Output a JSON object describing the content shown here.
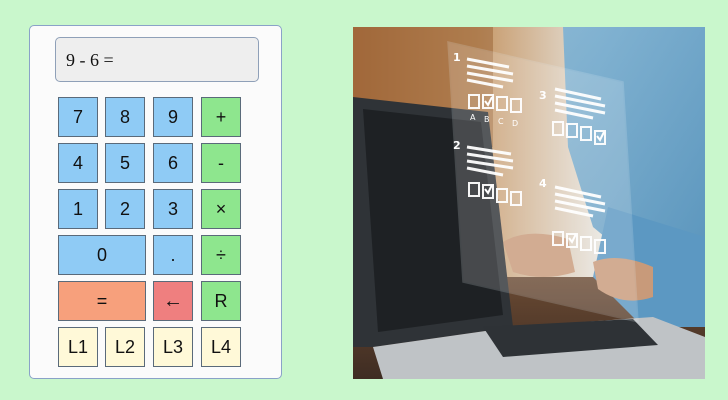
{
  "display": {
    "expression": "9 - 6 ="
  },
  "keys": {
    "k7": "7",
    "k8": "8",
    "k9": "9",
    "plus": "+",
    "k4": "4",
    "k5": "5",
    "k6": "6",
    "minus": "-",
    "k1": "1",
    "k2": "2",
    "k3": "3",
    "times": "×",
    "k0": "0",
    "dot": ".",
    "divide": "÷",
    "equals": "=",
    "backspace": "←",
    "reset": "R",
    "l1": "L1",
    "l2": "L2",
    "l3": "L3",
    "l4": "L4"
  },
  "photo": {
    "question_numbers": [
      "1",
      "2",
      "3",
      "4"
    ],
    "choice_letters": [
      "A",
      "B",
      "C",
      "D"
    ]
  },
  "colors": {
    "background": "#c9f7cc",
    "number_key": "#8fcbf5",
    "operator_key": "#8ee68e",
    "equals_key": "#f7a07c",
    "backspace_key": "#ef7f7f",
    "memory_key": "#fff9d8"
  }
}
